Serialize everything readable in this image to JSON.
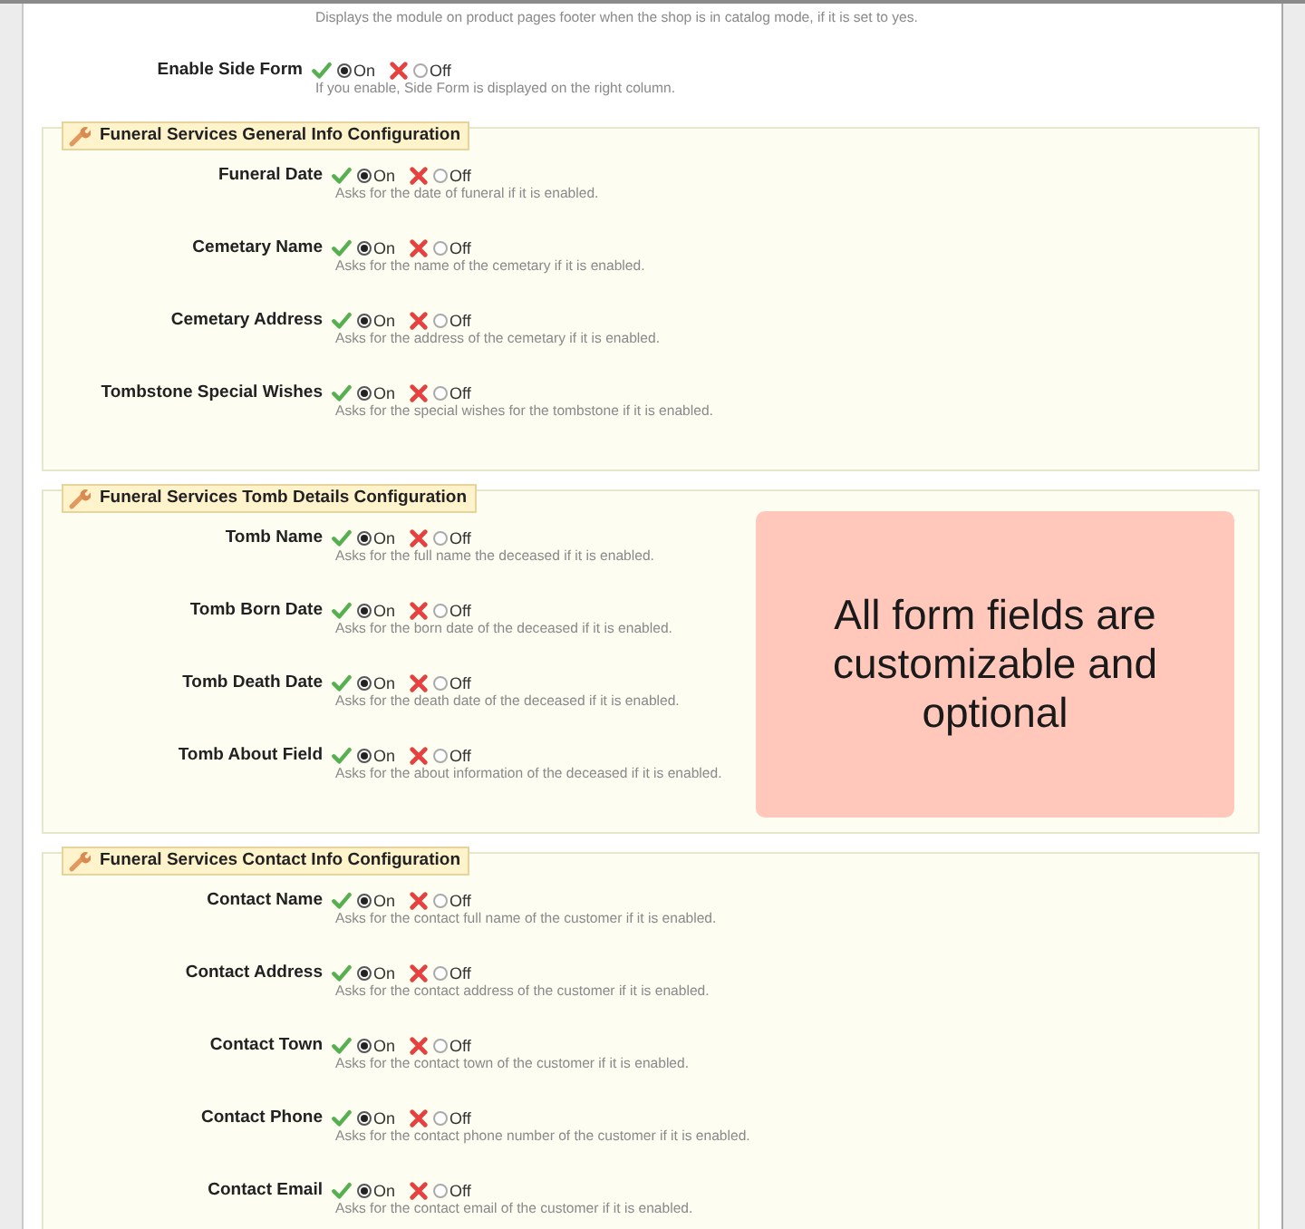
{
  "top_row": {
    "description": "Displays the module on product pages footer when the shop is in catalog mode, if it is set to yes."
  },
  "settings": [
    {
      "label": "Enable Side Form",
      "options": [
        {
          "kind": "on",
          "label": "On",
          "selected": true
        },
        {
          "kind": "off",
          "label": "Off",
          "selected": false
        }
      ],
      "description": "If you enable, Side Form is displayed on the right column."
    }
  ],
  "sections": [
    {
      "title": "Funeral Services General Info Configuration",
      "fields": [
        {
          "label": "Funeral Date",
          "options": [
            {
              "kind": "on",
              "label": "On",
              "selected": true
            },
            {
              "kind": "off",
              "label": "Off",
              "selected": false
            }
          ],
          "description": "Asks for the date of funeral if it is enabled."
        },
        {
          "label": "Cemetary Name",
          "options": [
            {
              "kind": "on",
              "label": "On",
              "selected": true
            },
            {
              "kind": "off",
              "label": "Off",
              "selected": false
            }
          ],
          "description": "Asks for the name of the cemetary if it is enabled."
        },
        {
          "label": "Cemetary Address",
          "options": [
            {
              "kind": "on",
              "label": "On",
              "selected": true
            },
            {
              "kind": "off",
              "label": "Off",
              "selected": false
            }
          ],
          "description": "Asks for the address of the cemetary if it is enabled."
        },
        {
          "label": "Tombstone Special Wishes",
          "options": [
            {
              "kind": "on",
              "label": "On",
              "selected": true
            },
            {
              "kind": "off",
              "label": "Off",
              "selected": false
            }
          ],
          "description": "Asks for the special wishes for the tombstone if it is enabled."
        }
      ]
    },
    {
      "title": "Funeral Services Tomb Details Configuration",
      "fields": [
        {
          "label": "Tomb Name",
          "options": [
            {
              "kind": "on",
              "label": "On",
              "selected": true
            },
            {
              "kind": "off",
              "label": "Off",
              "selected": false
            }
          ],
          "description": "Asks for the full name the deceased if it is enabled."
        },
        {
          "label": "Tomb Born Date",
          "options": [
            {
              "kind": "on",
              "label": "On",
              "selected": true
            },
            {
              "kind": "off",
              "label": "Off",
              "selected": false
            }
          ],
          "description": "Asks for the born date of the deceased if it is enabled."
        },
        {
          "label": "Tomb Death Date",
          "options": [
            {
              "kind": "on",
              "label": "On",
              "selected": true
            },
            {
              "kind": "off",
              "label": "Off",
              "selected": false
            }
          ],
          "description": "Asks for the death date of the deceased if it is enabled."
        },
        {
          "label": "Tomb About Field",
          "options": [
            {
              "kind": "on",
              "label": "On",
              "selected": true
            },
            {
              "kind": "off",
              "label": "Off",
              "selected": false
            }
          ],
          "description": "Asks for the about information of the deceased if it is enabled."
        }
      ],
      "callout": "All form fields are customizable and optional"
    },
    {
      "title": "Funeral Services Contact Info Configuration",
      "fields": [
        {
          "label": "Contact Name",
          "options": [
            {
              "kind": "on",
              "label": "On",
              "selected": true
            },
            {
              "kind": "off",
              "label": "Off",
              "selected": false
            }
          ],
          "description": "Asks for the contact full name of the customer if it is enabled."
        },
        {
          "label": "Contact Address",
          "options": [
            {
              "kind": "on",
              "label": "On",
              "selected": true
            },
            {
              "kind": "off",
              "label": "Off",
              "selected": false
            }
          ],
          "description": "Asks for the contact address of the customer if it is enabled."
        },
        {
          "label": "Contact Town",
          "options": [
            {
              "kind": "on",
              "label": "On",
              "selected": true
            },
            {
              "kind": "off",
              "label": "Off",
              "selected": false
            }
          ],
          "description": "Asks for the contact town of the customer if it is enabled."
        },
        {
          "label": "Contact Phone",
          "options": [
            {
              "kind": "on",
              "label": "On",
              "selected": true
            },
            {
              "kind": "off",
              "label": "Off",
              "selected": false
            }
          ],
          "description": "Asks for the contact phone number of the customer if it is enabled."
        },
        {
          "label": "Contact Email",
          "options": [
            {
              "kind": "on",
              "label": "On",
              "selected": true
            },
            {
              "kind": "off",
              "label": "Off",
              "selected": false
            }
          ],
          "description": "Asks for the contact email of the customer if it is enabled."
        }
      ]
    }
  ]
}
